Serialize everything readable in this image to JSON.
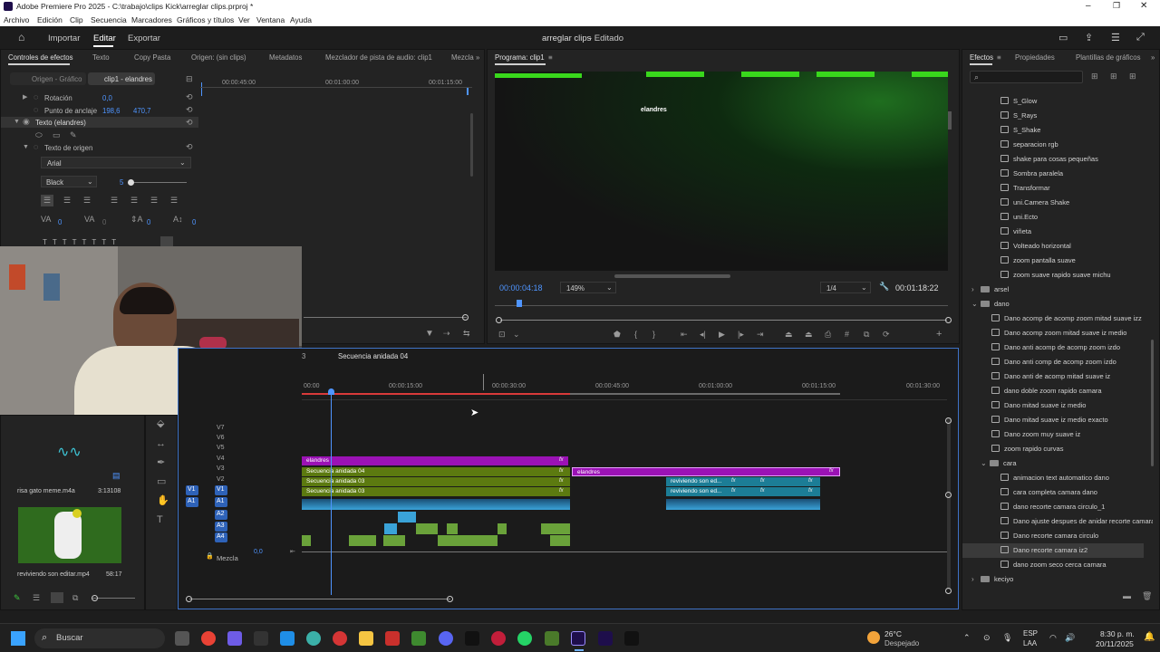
{
  "window": {
    "title": "Adobe Premiere Pro 2025 - C:\\trabajo\\clips Kick\\arreglar clips.prproj *"
  },
  "menu": [
    "Archivo",
    "Edición",
    "Clip",
    "Secuencia",
    "Marcadores",
    "Gráficos y títulos",
    "Ver",
    "Ventana",
    "Ayuda"
  ],
  "toolbar": {
    "import": "Importar",
    "edit": "Editar",
    "export": "Exportar",
    "project_title": "arreglar clips",
    "project_status": "- Editado"
  },
  "source_panel": {
    "tabs": [
      "Controles de efectos",
      "Texto",
      "Copy Pasta",
      "Origen: (sin clips)",
      "Metadatos",
      "Mezclador de pista de audio: clip1",
      "Mezcla"
    ],
    "subtabs": [
      "Origen - Gráfico",
      "clip1 - elandres"
    ],
    "timecodes": [
      "00:00:45:00",
      "00:01:00:00",
      "00:01:15:00"
    ],
    "rotation_label": "Rotación",
    "rotation_value": "0,0",
    "anchor_label": "Punto de anclaje",
    "anchor_x": "198,6",
    "anchor_y": "470,7",
    "text_label": "Texto (elandres)",
    "source_text_label": "Texto de origen",
    "font": "Arial",
    "font_style": "Black",
    "font_size": "5",
    "tracking_values": [
      "0",
      "0",
      "0",
      "0"
    ]
  },
  "program_monitor": {
    "title": "Programa: clip1",
    "overlay_text": "elandres",
    "timecode": "00:00:04:18",
    "zoom": "149%",
    "quality": "1/4",
    "duration": "00:01:18:22"
  },
  "project_bin": {
    "items": [
      {
        "name": "risa gato meme.m4a",
        "duration": "3:13108"
      },
      {
        "name": "reviviendo son editar.mp4",
        "duration": "58:17"
      }
    ]
  },
  "timeline": {
    "sequence_tab_partial": "3",
    "sequence_tab": "Secuencia anidada 04",
    "timecodes": [
      "00:00",
      "00:00:15:00",
      "00:00:30:00",
      "00:00:45:00",
      "00:01:00:00",
      "00:01:15:00",
      "00:01:30:00"
    ],
    "video_tracks": [
      "V7",
      "V6",
      "V5",
      "V4",
      "V3",
      "V2",
      "V1"
    ],
    "audio_tracks": [
      "A1",
      "A2",
      "A3",
      "A4"
    ],
    "mix_label": "Mezcla",
    "mix_value": "0,0",
    "src_v": "V1",
    "src_a": "A1",
    "clips": {
      "v4": "elandres",
      "v4b": "elandres",
      "v3": "Secuencia anidada 04",
      "v2": "Secuencia anidada 03",
      "v1": "Secuencia anidada 03",
      "v2b": "reviviendo son ed...",
      "v1b": "reviviendo son ed..."
    },
    "fx": "fx"
  },
  "effects_panel": {
    "tabs": [
      "Efectos",
      "Propiedades",
      "Plantillas de gráficos"
    ],
    "items": [
      {
        "t": "fx",
        "label": "S_Glow",
        "indent": 2
      },
      {
        "t": "fx",
        "label": "S_Rays",
        "indent": 2
      },
      {
        "t": "fx",
        "label": "S_Shake",
        "indent": 2
      },
      {
        "t": "fx",
        "label": "separacion rgb",
        "indent": 2
      },
      {
        "t": "fx",
        "label": "shake para cosas pequeñas",
        "indent": 2
      },
      {
        "t": "fx",
        "label": "Sombra paralela",
        "indent": 2
      },
      {
        "t": "fx",
        "label": "Transformar",
        "indent": 2
      },
      {
        "t": "fx",
        "label": "uni.Camera Shake",
        "indent": 2
      },
      {
        "t": "fx",
        "label": "uni.Ecto",
        "indent": 2
      },
      {
        "t": "fx",
        "label": "viñeta",
        "indent": 2
      },
      {
        "t": "fx",
        "label": "Volteado horizontal",
        "indent": 2
      },
      {
        "t": "fx",
        "label": "zoom pantalla suave",
        "indent": 2
      },
      {
        "t": "fx",
        "label": "zoom suave rapido suave michu",
        "indent": 2
      },
      {
        "t": "folder",
        "label": "arsel",
        "indent": 0,
        "open": false
      },
      {
        "t": "folder",
        "label": "dano",
        "indent": 0,
        "open": true
      },
      {
        "t": "fx",
        "label": "Dano acomp de acomp zoom mitad suave izz",
        "indent": 1
      },
      {
        "t": "fx",
        "label": "Dano acomp zoom mitad suave iz medio",
        "indent": 1
      },
      {
        "t": "fx",
        "label": "Dano anti acomp de acomp zoom izdo",
        "indent": 1
      },
      {
        "t": "fx",
        "label": "Dano anti comp de acomp zoom izdo",
        "indent": 1
      },
      {
        "t": "fx",
        "label": "Dano anti de acomp mitad suave iz",
        "indent": 1
      },
      {
        "t": "fx",
        "label": "dano doble zoom rapido camara",
        "indent": 1
      },
      {
        "t": "fx",
        "label": "Dano mitad suave iz medio",
        "indent": 1
      },
      {
        "t": "fx",
        "label": "Dano mitad suave iz medio exacto",
        "indent": 1
      },
      {
        "t": "fx",
        "label": "Dano zoom muy suave iz",
        "indent": 1
      },
      {
        "t": "fx",
        "label": "zoom rapido curvas",
        "indent": 1
      },
      {
        "t": "folder",
        "label": "cara",
        "indent": 1,
        "open": true
      },
      {
        "t": "fx",
        "label": "animacion text automatico dano",
        "indent": 2
      },
      {
        "t": "fx",
        "label": "cara completa camara dano",
        "indent": 2
      },
      {
        "t": "fx",
        "label": "dano recorte camara circulo_1",
        "indent": 2
      },
      {
        "t": "fx",
        "label": "Dano ajuste despues de anidar recorte camara iz",
        "indent": 2
      },
      {
        "t": "fx",
        "label": "Dano recorte  camara circulo",
        "indent": 2
      },
      {
        "t": "fx",
        "label": "Dano recorte camara iz2",
        "indent": 2,
        "selected": true
      },
      {
        "t": "fx",
        "label": "dano zoom seco cerca camara",
        "indent": 2
      },
      {
        "t": "folder",
        "label": "keciyo",
        "indent": 0,
        "open": false
      }
    ]
  },
  "taskbar": {
    "search": "Buscar",
    "weather_temp": "26°C",
    "weather_desc": "Despejado",
    "lang": "ESP",
    "lang2": "LAA",
    "time": "8:30 p. m.",
    "date": "20/11/2025"
  },
  "colors": {
    "accent": "#4f95ff",
    "v4_clip": "#9b12b5",
    "nested_clip": "#5c7a10",
    "audio_clip": "#3aa3d8",
    "teal_clip": "#1c7d96",
    "green_audio": "#6aa23a",
    "monitor_bars": "#39d81c"
  }
}
